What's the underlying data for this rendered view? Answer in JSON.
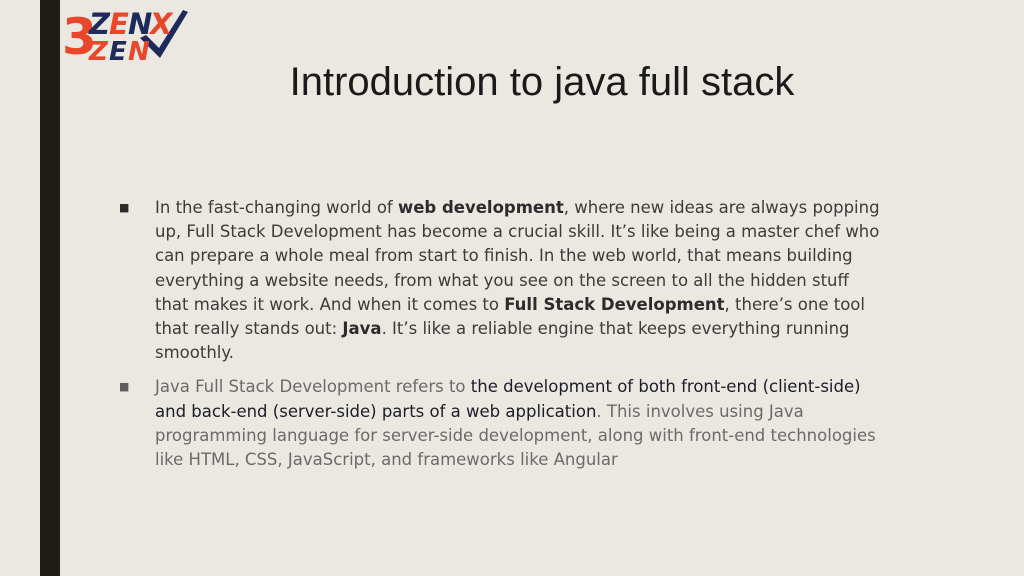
{
  "logo": {
    "brand_text": "3ZENX",
    "colors": {
      "red": "#e8472b",
      "navy": "#1e2a5a"
    }
  },
  "title": "Introduction to java full stack",
  "bullets": [
    {
      "marker": "■",
      "segments": [
        {
          "text": "In the fast-changing world of ",
          "bold": false
        },
        {
          "text": "web development",
          "bold": true
        },
        {
          "text": ", where new ideas are always popping\nup, Full Stack Development has become a crucial skill. It’s like being a master chef who\ncan prepare a whole meal from start to finish. In the web world, that means building\neverything a website needs, from what you see on the screen to all the hidden stuff\nthat makes it work. And when it comes to ",
          "bold": false
        },
        {
          "text": "Full Stack Development",
          "bold": true
        },
        {
          "text": ", there’s one tool\nthat really stands out: ",
          "bold": false
        },
        {
          "text": "Java",
          "bold": true
        },
        {
          "text": ". It’s like a reliable engine that keeps everything running\nsmoothly.",
          "bold": false
        }
      ]
    },
    {
      "marker": "■",
      "segments": [
        {
          "text": "Java Full Stack Development refers to ",
          "highlight": false
        },
        {
          "text": "the development of both front-end (client-side)\nand back-end (server-side) parts of a web application",
          "highlight": true
        },
        {
          "text": ". This involves using Java\nprogramming language for server-side development, along with front-end technologies\nlike HTML, CSS, JavaScript, and frameworks like Angular",
          "highlight": false
        }
      ]
    }
  ]
}
